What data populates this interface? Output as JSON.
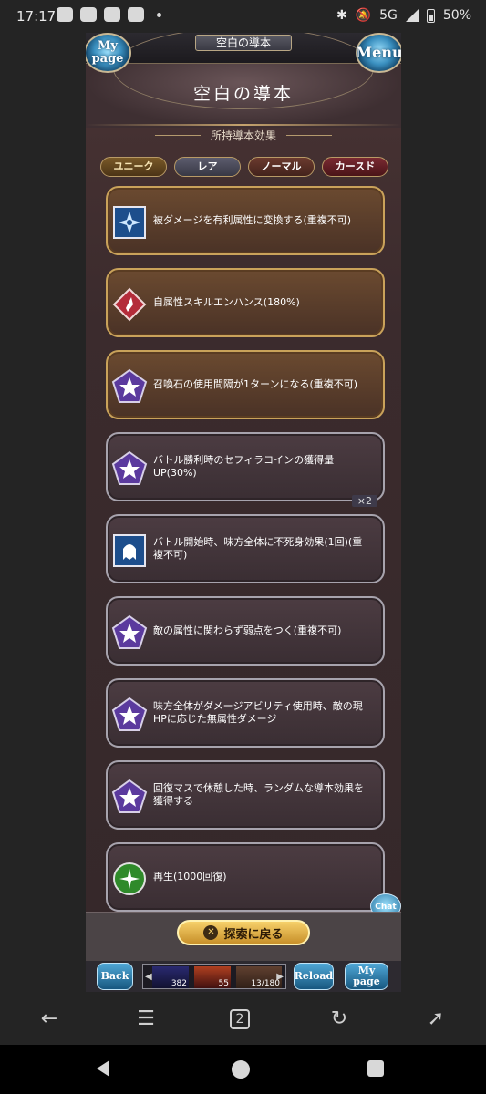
{
  "status_bar": {
    "time": "17:17",
    "network": "5G",
    "battery": "50%"
  },
  "window": {
    "title": "空白の導本"
  },
  "header": {
    "page_title": "空白の導本",
    "left_button": "My page",
    "left_button_line1": "My",
    "left_button_line2": "page",
    "right_button": "Menu"
  },
  "subtitle": "所持導本効果",
  "tabs": [
    {
      "label": "ユニーク"
    },
    {
      "label": "レア"
    },
    {
      "label": "ノーマル"
    },
    {
      "label": "カースド"
    }
  ],
  "effects": [
    {
      "text": "被ダメージを有利属性に変換する(重複不可)",
      "rarity": "gold",
      "icon": "pinwheel-icon"
    },
    {
      "text": "自属性スキルエンハンス(180%)",
      "rarity": "gold",
      "icon": "crystal-icon"
    },
    {
      "text": "召喚石の使用間隔が1ターンになる(重複不可)",
      "rarity": "gold",
      "icon": "star-pentagon-icon"
    },
    {
      "text": "バトル勝利時のセフィラコインの獲得量UP(30%)",
      "rarity": "silver",
      "icon": "star-pentagon-icon",
      "count": "×2"
    },
    {
      "text": "バトル開始時、味方全体に不死身効果(1回)(重複不可)",
      "rarity": "silver",
      "icon": "ghost-icon"
    },
    {
      "text": "敵の属性に関わらず弱点をつく(重複不可)",
      "rarity": "silver",
      "icon": "star-pentagon-icon"
    },
    {
      "text": "味方全体がダメージアビリティ使用時、敵の現HPに応じた無属性ダメージ",
      "rarity": "silver",
      "icon": "star-pentagon-icon"
    },
    {
      "text": "回復マスで休憩した時、ランダムな導本効果を獲得する",
      "rarity": "silver",
      "icon": "star-pentagon-icon"
    },
    {
      "text": "再生(1000回復)",
      "rarity": "silver",
      "icon": "sparkle-icon"
    }
  ],
  "chat_label": "Chat",
  "explore_button": "探索に戻る",
  "footer": {
    "back": "Back",
    "reload": "Reload",
    "mypage_line1": "My",
    "mypage_line2": "page",
    "party_values": [
      "382",
      "55",
      "13/180"
    ]
  },
  "colors": {
    "accent_gold": "#c9a25a",
    "frame_silver": "#a7a3ad",
    "button_blue": "#17577f"
  }
}
